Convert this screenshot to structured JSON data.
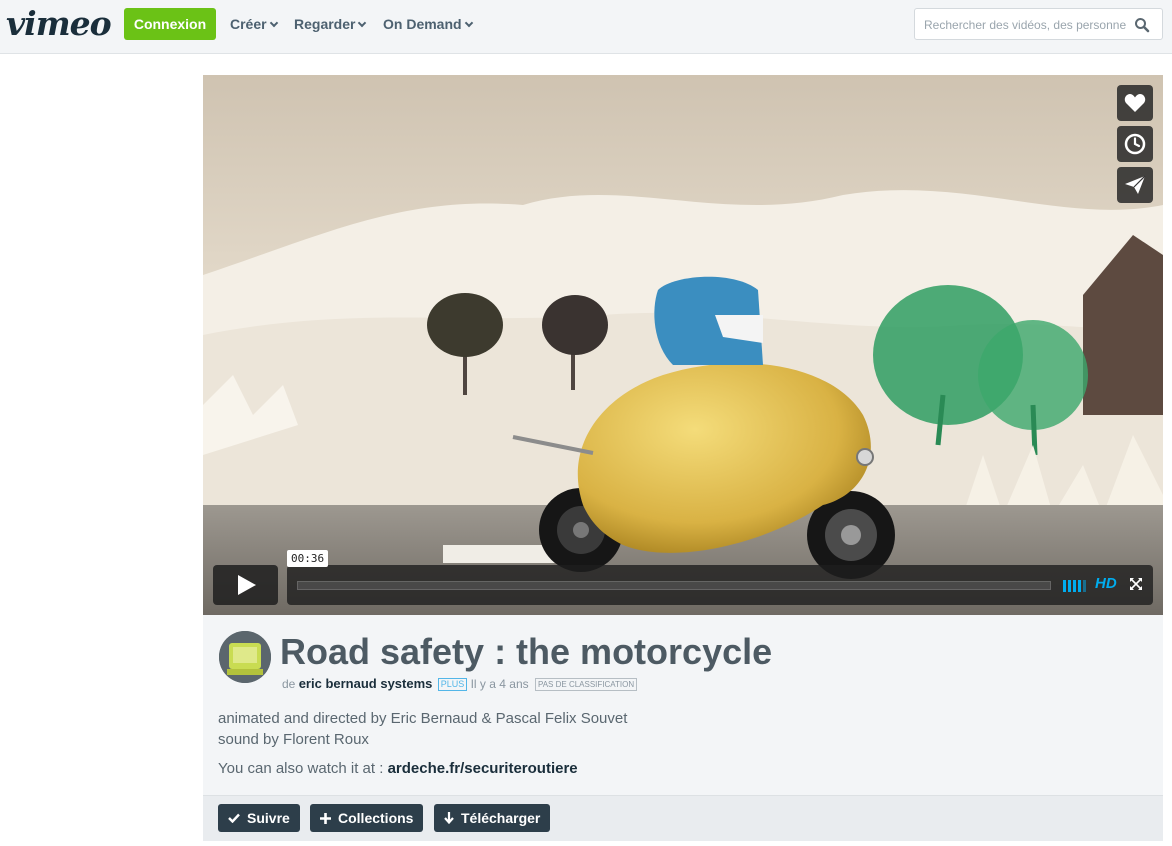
{
  "header": {
    "logo": "vimeo",
    "login_label": "Connexion",
    "nav": [
      {
        "label": "Créer"
      },
      {
        "label": "Regarder"
      },
      {
        "label": "On Demand"
      }
    ],
    "search_placeholder": "Rechercher des vidéos, des personnes"
  },
  "player": {
    "time": "00:36",
    "quality": "HD",
    "side_icons": [
      "heart-icon",
      "clock-icon",
      "paper-plane-icon"
    ]
  },
  "video": {
    "title": "Road safety : the motorcycle",
    "by_prefix": "de",
    "author": "eric bernaud systems",
    "plus_badge": "PLUS",
    "age": "Il y a 4 ans",
    "rating": "PAS DE CLASSIFICATION",
    "description_line1": "animated and directed by Eric Bernaud & Pascal Felix Souvet",
    "description_line2": "sound by Florent Roux",
    "watch_prefix": "You can also watch it at :",
    "watch_link": "ardeche.fr/securiteroutiere"
  },
  "actions": {
    "follow": "Suivre",
    "collections": "Collections",
    "download": "Télécharger"
  },
  "colors": {
    "login_green": "#6bc216",
    "hd_blue": "#00adef",
    "action_dark": "#2d3e4a"
  }
}
